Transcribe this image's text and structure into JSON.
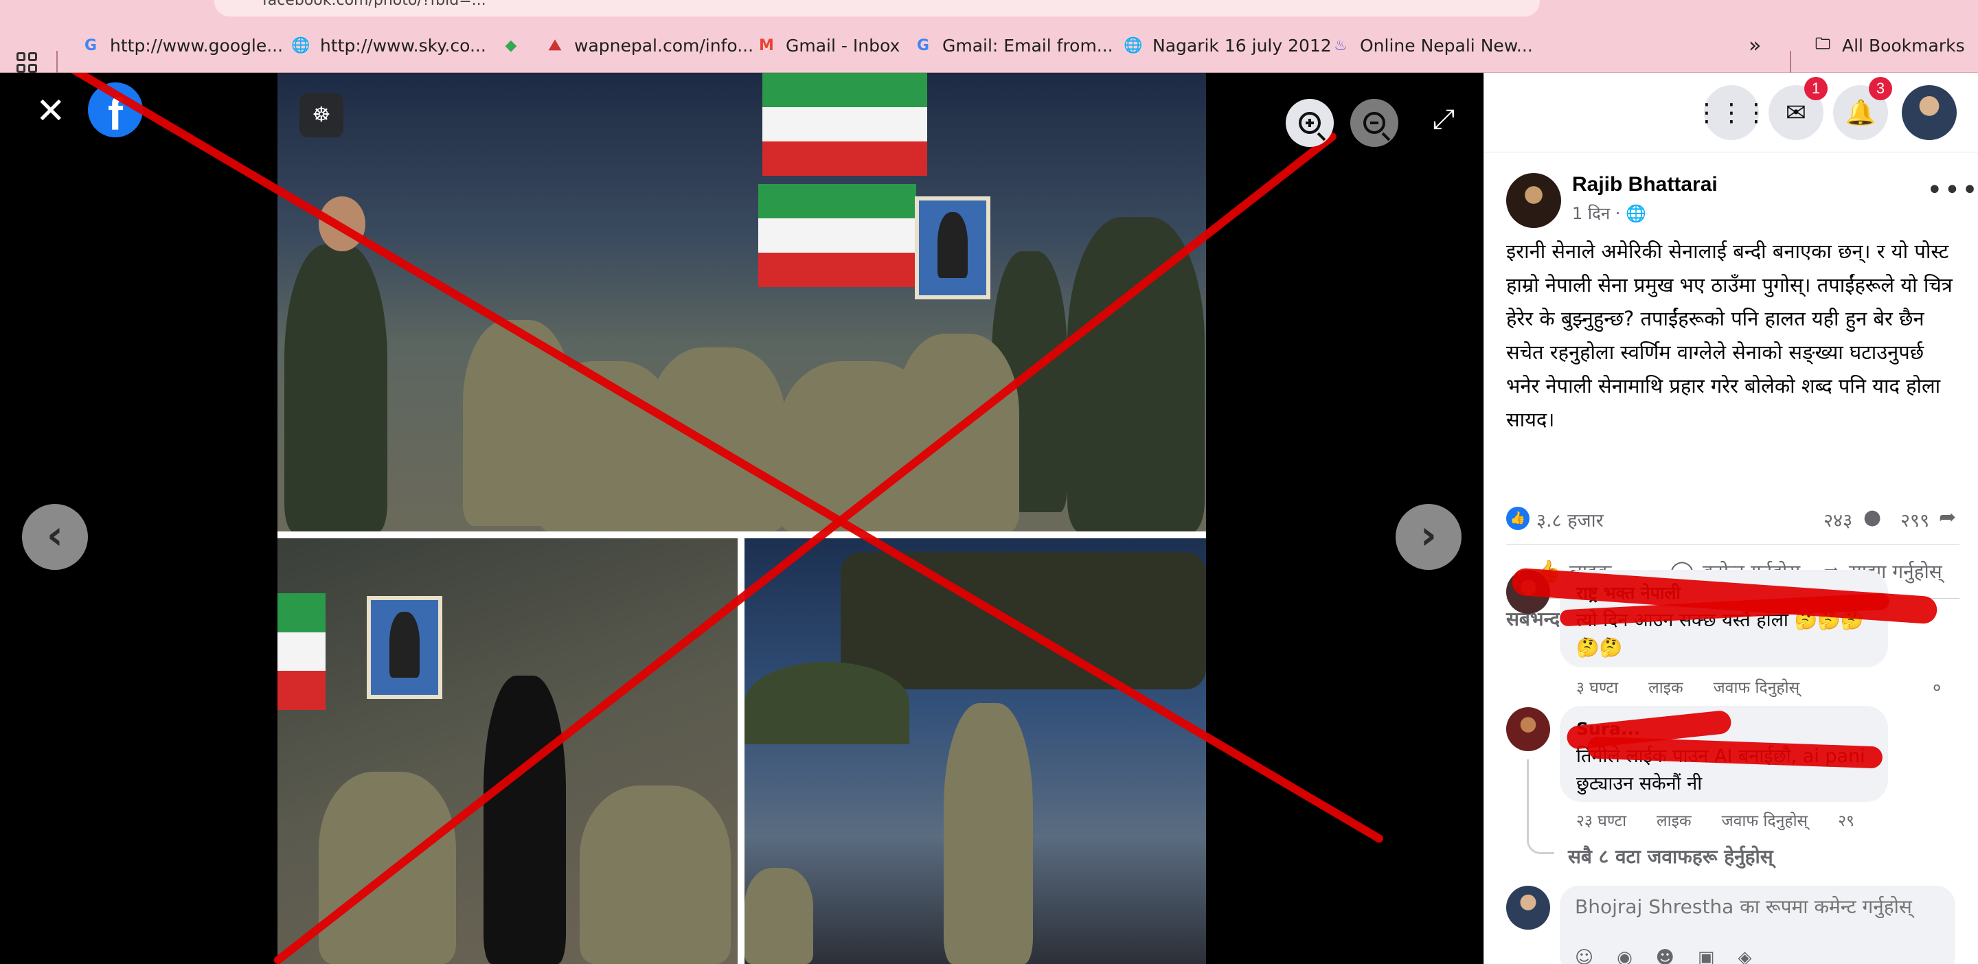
{
  "browser": {
    "url": "facebook.com/photo/?fbid=...",
    "bookmarks": [
      {
        "icon": "google-icon",
        "label": "http://www.google..."
      },
      {
        "icon": "globe-icon",
        "label": "http://www.sky.co..."
      },
      {
        "icon": "maps-icon",
        "label": ""
      },
      {
        "icon": "wapnepal-icon",
        "label": "wapnepal.com/info..."
      },
      {
        "icon": "gmail-icon",
        "label": "Gmail - Inbox"
      },
      {
        "icon": "google-icon",
        "label": "Gmail: Email from..."
      },
      {
        "icon": "globe-icon",
        "label": "Nagarik 16 july 2012"
      },
      {
        "icon": "news-icon",
        "label": "Online Nepali New..."
      }
    ],
    "overflow": "»",
    "all_bookmarks": "All Bookmarks"
  },
  "viewer": {
    "close": "✕",
    "logo": "f",
    "fullscreen": "⤢",
    "prev": "‹",
    "next": "›"
  },
  "topbar": {
    "messenger_badge": "1",
    "notifications_badge": "3"
  },
  "post": {
    "author": "Rajib Bhattarai",
    "time": "1 दिन ·",
    "privacy_icon": "🌐",
    "more": "•••",
    "text": "इरानी सेनाले अमेरिकी सेनालाई बन्दी बनाएका छन्। र यो पोस्ट हाम्रो नेपाली सेना प्रमुख भए ठाउँमा पुगोस्। तपाईंहरूले यो चित्र हेरेर के बुझ्नुहुन्छ? तपाईंहरूको पनि हालत यही हुन बेर छैन सचेत रहनुहोला स्वर्णिम वाग्लेले सेनाको सङ्ख्या घटाउनुपर्छ भनेर नेपाली सेनामाथि प्रहार गरेर बोलेको शब्द पनि याद होला सायद।",
    "reactions": "३.८ हजार",
    "comments_count": "२४३",
    "shares_count": "२९९"
  },
  "actions": {
    "like": "लाइक",
    "comment": "कमेन्ट गर्नुहोस्",
    "share": "साझा गर्नुहोस्"
  },
  "sort_label": "सबैभन्दा सान्दर्भिक",
  "comments": [
    {
      "name": "राष्ट्र भक्त नेपाली",
      "text": "त्यो दिन आउन सक्छ यस्तै होला 🤔🤔🤔🤔🤔",
      "time": "३ घण्टा",
      "like": "लाइक",
      "reply": "जवाफ दिनुहोस्",
      "count": "०"
    },
    {
      "name": "Sura...",
      "text": "तिमीले लाईक पाउन AI बनाईछौ, ai pani छुट्याउन सकेनौं नी",
      "time": "२३ घण्टा",
      "like": "लाइक",
      "reply": "जवाफ दिनुहोस्",
      "count": "२९"
    }
  ],
  "view_replies": "सबै ८ वटा जवाफहरू हेर्नुहोस्",
  "compose": {
    "placeholder": "Bhojraj Shrestha का रूपमा कमेन्ट गर्नुहोस्"
  }
}
